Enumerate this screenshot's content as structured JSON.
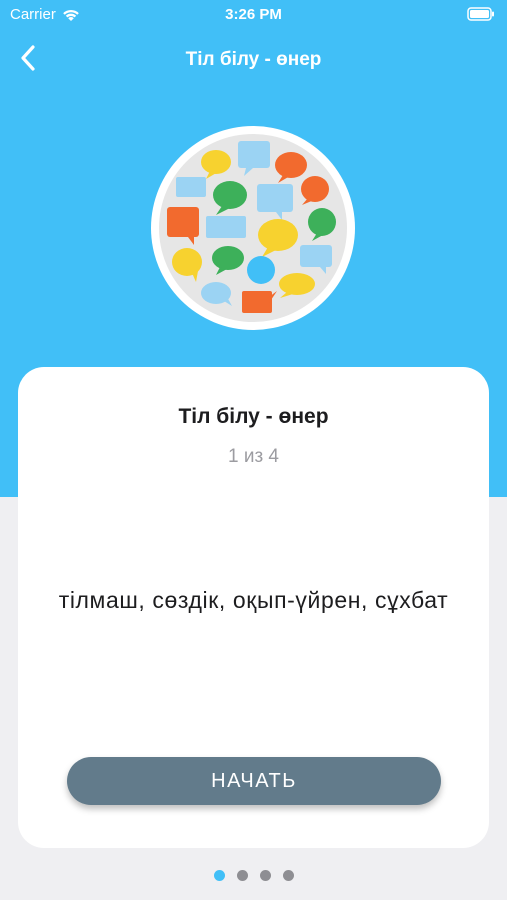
{
  "status_bar": {
    "carrier": "Carrier",
    "time": "3:26 PM",
    "wifi_icon": "wifi-icon",
    "battery_icon": "battery-icon"
  },
  "nav": {
    "title": "Тіл білу - өнер",
    "back_icon": "chevron-left-icon"
  },
  "illustration": {
    "icon": "speech-bubbles-icon",
    "bubble_colors": [
      "#F7D22F",
      "#F26A2E",
      "#3DB05A",
      "#9BD3F3",
      "#41BFF7"
    ]
  },
  "card": {
    "title": "Тіл білу - өнер",
    "progress": "1 из 4",
    "words": "тілмаш, сөздік, оқып-үйрен, сұхбат",
    "start_label": "НАЧАТЬ"
  },
  "pagination": {
    "total": 4,
    "current": 1
  },
  "colors": {
    "accent": "#41BFF7",
    "button": "#627B8B",
    "background": "#EFEFF2",
    "inactive_dot": "#8E8E93"
  }
}
